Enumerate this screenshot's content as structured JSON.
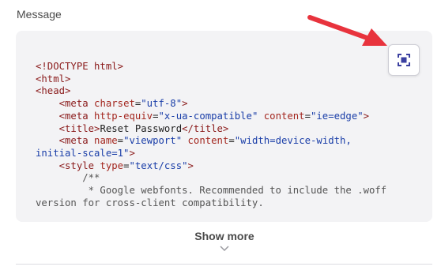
{
  "section": {
    "label": "Message"
  },
  "code": {
    "lines": [
      [
        {
          "t": "tag",
          "v": "<!DOCTYPE html>"
        }
      ],
      [
        {
          "t": "tag",
          "v": "<html>"
        }
      ],
      [
        {
          "t": "tag",
          "v": "<head>"
        }
      ],
      [
        {
          "t": "txt",
          "v": "    "
        },
        {
          "t": "tag",
          "v": "<meta "
        },
        {
          "t": "attr",
          "v": "charset"
        },
        {
          "t": "txt",
          "v": "="
        },
        {
          "t": "str",
          "v": "\"utf-8\""
        },
        {
          "t": "tag",
          "v": ">"
        }
      ],
      [
        {
          "t": "txt",
          "v": "    "
        },
        {
          "t": "tag",
          "v": "<meta "
        },
        {
          "t": "attr",
          "v": "http-equiv"
        },
        {
          "t": "txt",
          "v": "="
        },
        {
          "t": "str",
          "v": "\"x-ua-compatible\""
        },
        {
          "t": "txt",
          "v": " "
        },
        {
          "t": "attr",
          "v": "content"
        },
        {
          "t": "txt",
          "v": "="
        },
        {
          "t": "str",
          "v": "\"ie=edge\""
        },
        {
          "t": "tag",
          "v": ">"
        }
      ],
      [
        {
          "t": "txt",
          "v": "    "
        },
        {
          "t": "tag",
          "v": "<title>"
        },
        {
          "t": "txt",
          "v": "Reset Password"
        },
        {
          "t": "tag",
          "v": "</title>"
        }
      ],
      [
        {
          "t": "txt",
          "v": "    "
        },
        {
          "t": "tag",
          "v": "<meta "
        },
        {
          "t": "attr",
          "v": "name"
        },
        {
          "t": "txt",
          "v": "="
        },
        {
          "t": "str",
          "v": "\"viewport\""
        },
        {
          "t": "txt",
          "v": " "
        },
        {
          "t": "attr",
          "v": "content"
        },
        {
          "t": "txt",
          "v": "="
        },
        {
          "t": "str",
          "v": "\"width=device-width,"
        }
      ],
      [
        {
          "t": "str",
          "v": "initial-scale=1\""
        },
        {
          "t": "tag",
          "v": ">"
        }
      ],
      [
        {
          "t": "txt",
          "v": "    "
        },
        {
          "t": "tag",
          "v": "<style "
        },
        {
          "t": "attr",
          "v": "type"
        },
        {
          "t": "txt",
          "v": "="
        },
        {
          "t": "str",
          "v": "\"text/css\""
        },
        {
          "t": "tag",
          "v": ">"
        }
      ],
      [
        {
          "t": "cmt",
          "v": "        /**"
        }
      ],
      [
        {
          "t": "cmt",
          "v": "         * Google webfonts. Recommended to include the .woff"
        }
      ],
      [
        {
          "t": "cmt",
          "v": "version for cross-client compatibility."
        }
      ]
    ]
  },
  "expand_button": {
    "icon": "expand-icon"
  },
  "show_more": {
    "label": "Show more",
    "icon": "chevron-down-icon"
  },
  "colors": {
    "accent": "#3a3fa0",
    "annotation_arrow": "#e8333d",
    "code_background": "#f3f3f5"
  }
}
